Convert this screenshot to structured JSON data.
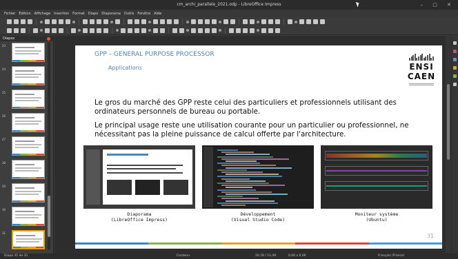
{
  "window": {
    "title": "cm_archi_parallele_2021.odp - LibreOffice Impress",
    "controls": "–  ▢  ✕"
  },
  "menu": [
    "Fichier",
    "Édition",
    "Affichage",
    "Insertion",
    "Format",
    "Diapo",
    "Diaporama",
    "Outils",
    "Fenêtre",
    "Aide"
  ],
  "slides_panel": {
    "title": "Diapos",
    "numbers": [
      "23",
      "24",
      "25",
      "26",
      "27",
      "28",
      "29",
      "30",
      "31"
    ],
    "active_index": 8
  },
  "slide": {
    "title": "GPP – GENERAL PURPOSE PROCESSOR",
    "subtitle": "Applications",
    "logo_line1": "ENSI",
    "logo_line2": "CAEN",
    "paragraph1": "Le gros du marché des GPP reste celui des particuliers et professionnels utilisant des ordinateurs personnels de bureau ou portable.",
    "paragraph2": "Le principal usage reste une utilisation courante pour un particulier ou professionnel, ne nécessitant pas la pleine puissance de calcul offerte par l'architecture.",
    "captions": [
      {
        "line1": "Diaporama",
        "line2": "(LibreOffice Impress)"
      },
      {
        "line1": "Développement",
        "line2": "(Visual Studio Code)"
      },
      {
        "line1": "Moniteur système",
        "line2": "(Ubuntu)"
      }
    ],
    "page_number": "31",
    "band_colors": [
      "#3b82c4",
      "#8bb24a",
      "#e0a42c",
      "#d4493a",
      "#4a9bd6"
    ]
  },
  "status": {
    "left": "Diapo 31 de 31",
    "center": "Contenu",
    "coords": "20,78 / 11,49",
    "size": "0,00 x 0,00",
    "language": "Français (France)"
  }
}
